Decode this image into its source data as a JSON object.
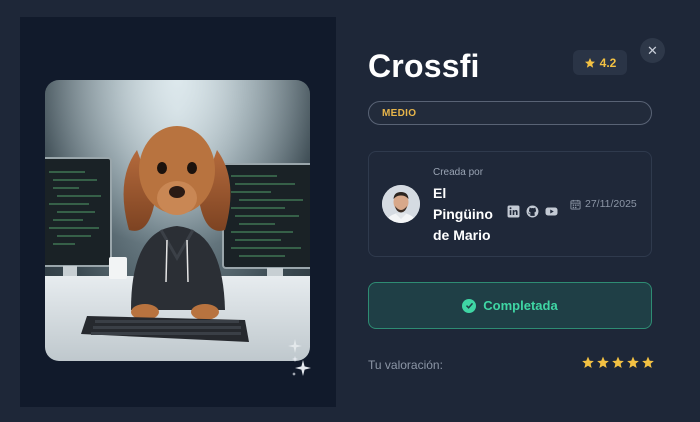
{
  "challenge": {
    "title": "Crossfi",
    "rating": "4.2",
    "level": "MEDIO"
  },
  "creator": {
    "created_by_label": "Creada por",
    "name": "El Pingüino de Mario",
    "date": "27/11/2025",
    "socials": [
      "linkedin-icon",
      "github-icon",
      "youtube-icon"
    ]
  },
  "status": {
    "label": "Completada"
  },
  "user_rating": {
    "label": "Tu valoración:",
    "stars": 5
  },
  "colors": {
    "accent_gold": "#f3c143",
    "success": "#3fd6a4",
    "background": "#1e2738"
  }
}
